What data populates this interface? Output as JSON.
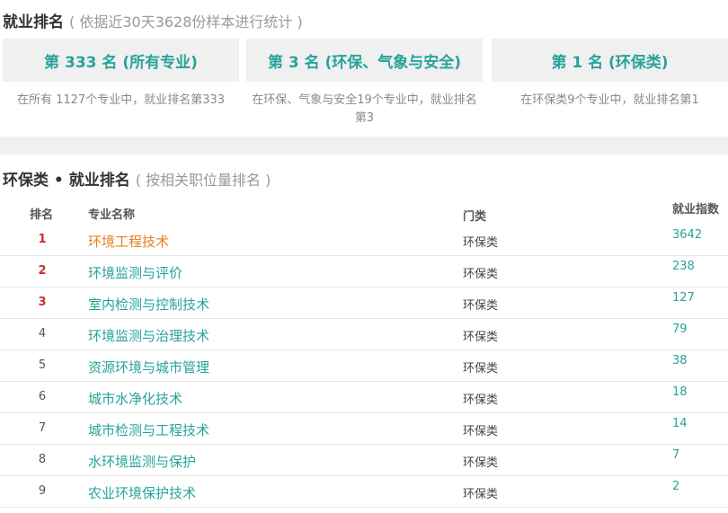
{
  "section1": {
    "title": "就业排名",
    "subtitle": "( 依据近30天3628份样本进行统计 )"
  },
  "cards": [
    {
      "heading": "第 333 名 (所有专业)",
      "description": "在所有 1127个专业中，就业排名第333"
    },
    {
      "heading": "第 3 名 (环保、气象与安全)",
      "description": "在环保、气象与安全19个专业中，就业排名第3"
    },
    {
      "heading": "第 1 名 (环保类)",
      "description": "在环保类9个专业中，就业排名第1"
    }
  ],
  "section2": {
    "title": "环保类 • 就业排名",
    "subtitle": "( 按相关职位量排名 )"
  },
  "table": {
    "headers": {
      "rank": "排名",
      "name": "专业名称",
      "category": "门类",
      "index": "就业指数"
    },
    "rows": [
      {
        "rank": "1",
        "name": "环境工程技术",
        "category": "环保类",
        "index": "3642"
      },
      {
        "rank": "2",
        "name": "环境监测与评价",
        "category": "环保类",
        "index": "238"
      },
      {
        "rank": "3",
        "name": "室内检测与控制技术",
        "category": "环保类",
        "index": "127"
      },
      {
        "rank": "4",
        "name": "环境监测与治理技术",
        "category": "环保类",
        "index": "79"
      },
      {
        "rank": "5",
        "name": "资源环境与城市管理",
        "category": "环保类",
        "index": "38"
      },
      {
        "rank": "6",
        "name": "城市水净化技术",
        "category": "环保类",
        "index": "18"
      },
      {
        "rank": "7",
        "name": "城市检测与工程技术",
        "category": "环保类",
        "index": "14"
      },
      {
        "rank": "8",
        "name": "水环境监测与保护",
        "category": "环保类",
        "index": "7"
      },
      {
        "rank": "9",
        "name": "农业环境保护技术",
        "category": "环保类",
        "index": "2"
      }
    ]
  },
  "colors": {
    "accent": "#27a39a",
    "active_link": "#e67e22",
    "top_rank": "#c9302c",
    "card_bg": "#f0f0f0"
  }
}
